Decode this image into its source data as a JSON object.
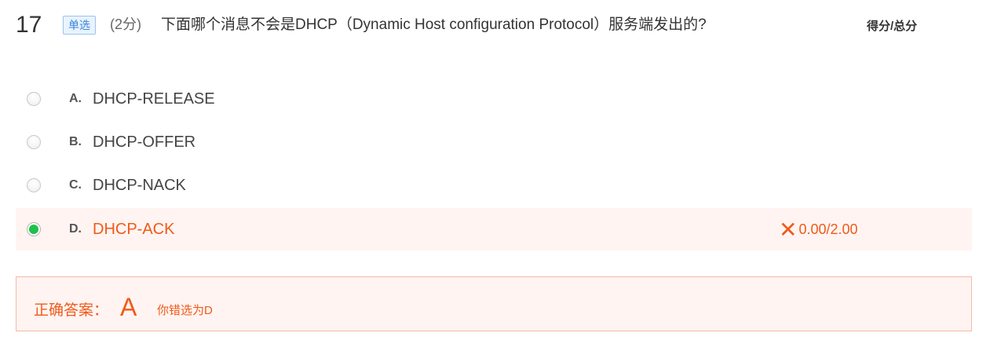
{
  "question": {
    "number": "17",
    "type_label": "单选",
    "points": "(2分)",
    "text": "下面哪个消息不会是DHCP（Dynamic Host configuration Protocol）服务端发出的?",
    "score_header": "得分/总分"
  },
  "options": [
    {
      "letter": "A.",
      "text": "DHCP-RELEASE",
      "selected": false
    },
    {
      "letter": "B.",
      "text": "DHCP-OFFER",
      "selected": false
    },
    {
      "letter": "C.",
      "text": "DHCP-NACK",
      "selected": false
    },
    {
      "letter": "D.",
      "text": "DHCP-ACK",
      "selected": true
    }
  ],
  "result": {
    "icon": "x-icon",
    "score": "0.00/2.00"
  },
  "answer": {
    "label": "正确答案：",
    "correct": "A",
    "note": "你错选为D"
  },
  "colors": {
    "error": "#f05a1a",
    "selected_radio": "#1ec14a",
    "badge": "#3a86d8"
  }
}
